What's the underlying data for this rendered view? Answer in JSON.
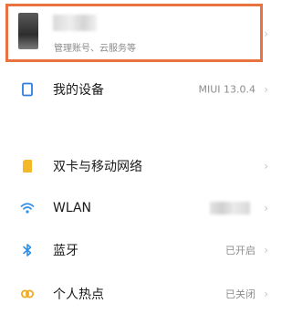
{
  "account": {
    "subtitle": "管理账号、云服务等"
  },
  "my_device": {
    "label": "我的设备",
    "value": "MIUI 13.0.4",
    "icon": "device-icon"
  },
  "network_items": [
    {
      "label": "双卡与移动网络",
      "value": "",
      "icon": "sim-card-icon"
    },
    {
      "label": "WLAN",
      "value": "",
      "icon": "wifi-icon"
    },
    {
      "label": "蓝牙",
      "value": "已开启",
      "icon": "bluetooth-icon"
    },
    {
      "label": "个人热点",
      "value": "已关闭",
      "icon": "hotspot-icon"
    }
  ],
  "chevron": "›",
  "colors": {
    "highlight": "#e8733f",
    "device_icon": "#2f7de1",
    "sim_icon": "#f3b928",
    "wifi_icon": "#2f8fe8",
    "bluetooth_icon": "#2f8fe8",
    "hotspot_icon": "#f0a81c"
  }
}
